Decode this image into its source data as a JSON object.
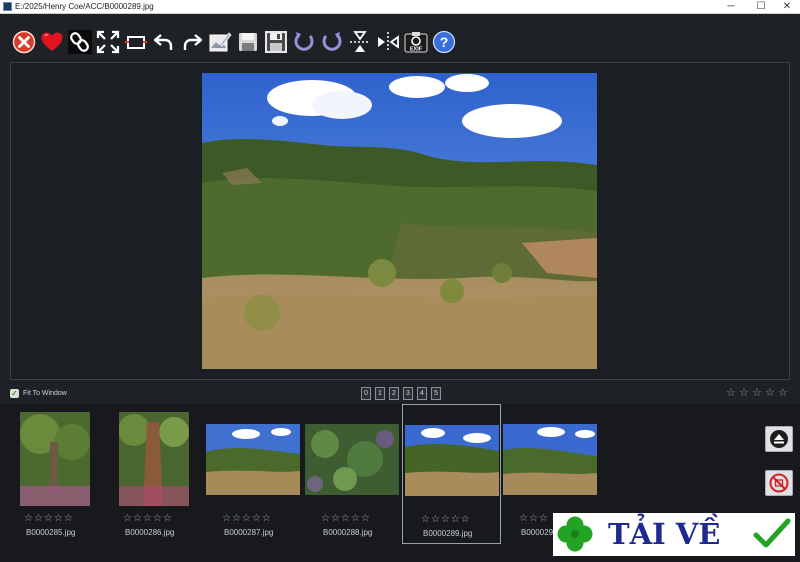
{
  "window": {
    "title": "E:/2025/Henry Coe/ACC/B0000289.jpg",
    "minimize_glyph": "─",
    "maximize_glyph": "☐",
    "close_glyph": "✕"
  },
  "toolbar": {
    "buttons": [
      {
        "name": "close-icon"
      },
      {
        "name": "heart-icon"
      },
      {
        "name": "link-icon"
      },
      {
        "name": "fullscreen-icon"
      },
      {
        "name": "crop-icon"
      },
      {
        "name": "undo-icon"
      },
      {
        "name": "redo-icon"
      },
      {
        "name": "edit-image-icon"
      },
      {
        "name": "save-icon"
      },
      {
        "name": "save-as-icon"
      },
      {
        "name": "rotate-left-icon"
      },
      {
        "name": "rotate-right-icon"
      },
      {
        "name": "flip-vertical-icon"
      },
      {
        "name": "flip-horizontal-icon"
      },
      {
        "name": "exif-icon",
        "label": "EXIF"
      },
      {
        "name": "help-icon",
        "label": "?"
      }
    ]
  },
  "viewer": {
    "fit_to_window_checked": true,
    "fit_to_window_label": "Fit To Window",
    "fit_check_glyph": "✓",
    "rating_buttons": [
      "0",
      "1",
      "2",
      "3",
      "4",
      "5"
    ],
    "current_rating_stars": [
      "☆",
      "☆",
      "☆",
      "☆",
      "☆"
    ]
  },
  "filmstrip": {
    "selected_index": 4,
    "thumbnails": [
      {
        "filename": "B0000285.jpg",
        "stars": "☆☆☆☆☆"
      },
      {
        "filename": "B0000286.jpg",
        "stars": "☆☆☆☆☆"
      },
      {
        "filename": "B0000287.jpg",
        "stars": "☆☆☆☆☆"
      },
      {
        "filename": "B0000288.jpg",
        "stars": "☆☆☆☆☆"
      },
      {
        "filename": "B0000289.jpg",
        "stars": "☆☆☆☆☆"
      },
      {
        "filename": "B000029",
        "stars": "☆☆☆"
      }
    ]
  },
  "side_buttons": [
    {
      "name": "eject-icon"
    },
    {
      "name": "no-entry-icon"
    }
  ],
  "watermark": {
    "text": "TẢI VỀ",
    "icon_names": [
      "clover-icon",
      "checkmark-icon"
    ]
  },
  "colors": {
    "background": "#1e2126",
    "panel_border": "#3b4048",
    "selected_border": "#9aa3ad",
    "watermark_text": "#1f2a8f",
    "watermark_green": "#22a322"
  }
}
